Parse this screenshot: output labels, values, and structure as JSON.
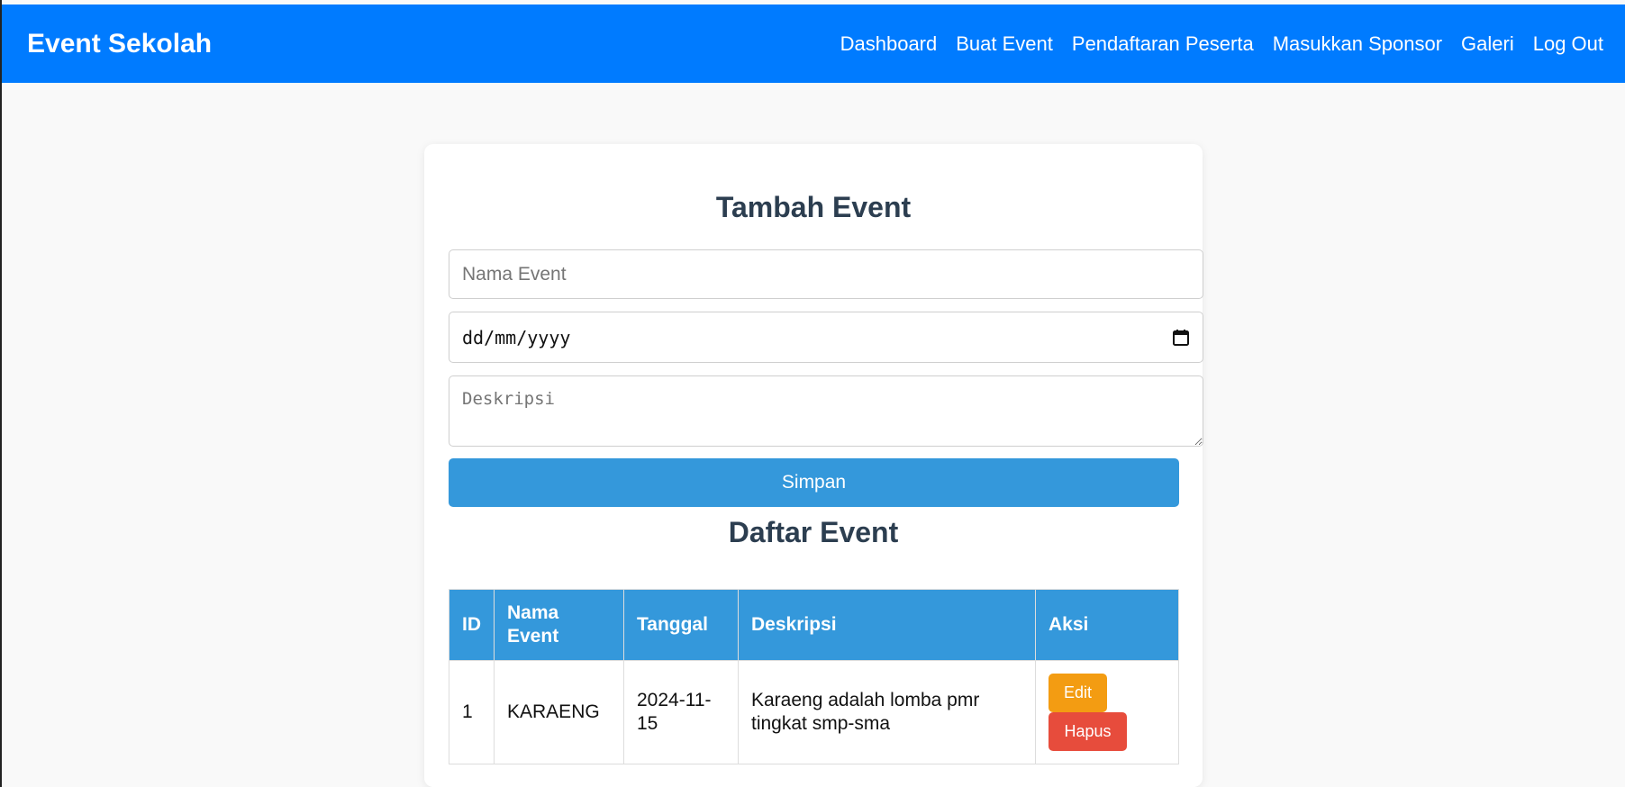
{
  "navbar": {
    "brand": "Event Sekolah",
    "links": [
      "Dashboard",
      "Buat Event",
      "Pendaftaran Peserta",
      "Masukkan Sponsor",
      "Galeri",
      "Log Out"
    ]
  },
  "form": {
    "title": "Tambah Event",
    "name_placeholder": "Nama Event",
    "date_placeholder": "dd/mm/yyyy",
    "description_placeholder": "Deskripsi",
    "submit_label": "Simpan"
  },
  "list": {
    "title": "Daftar Event",
    "columns": [
      "ID",
      "Nama Event",
      "Tanggal",
      "Deskripsi",
      "Aksi"
    ],
    "rows": [
      {
        "id": "1",
        "name": "KARAENG",
        "date": "2024-11-15",
        "description": "Karaeng adalah lomba pmr tingkat smp-sma",
        "edit_label": "Edit",
        "delete_label": "Hapus"
      }
    ]
  },
  "colors": {
    "navbar": "#007bff",
    "primary_button": "#3498db",
    "edit_button": "#f39c12",
    "delete_button": "#e74c3c",
    "heading": "#2c3e50"
  }
}
